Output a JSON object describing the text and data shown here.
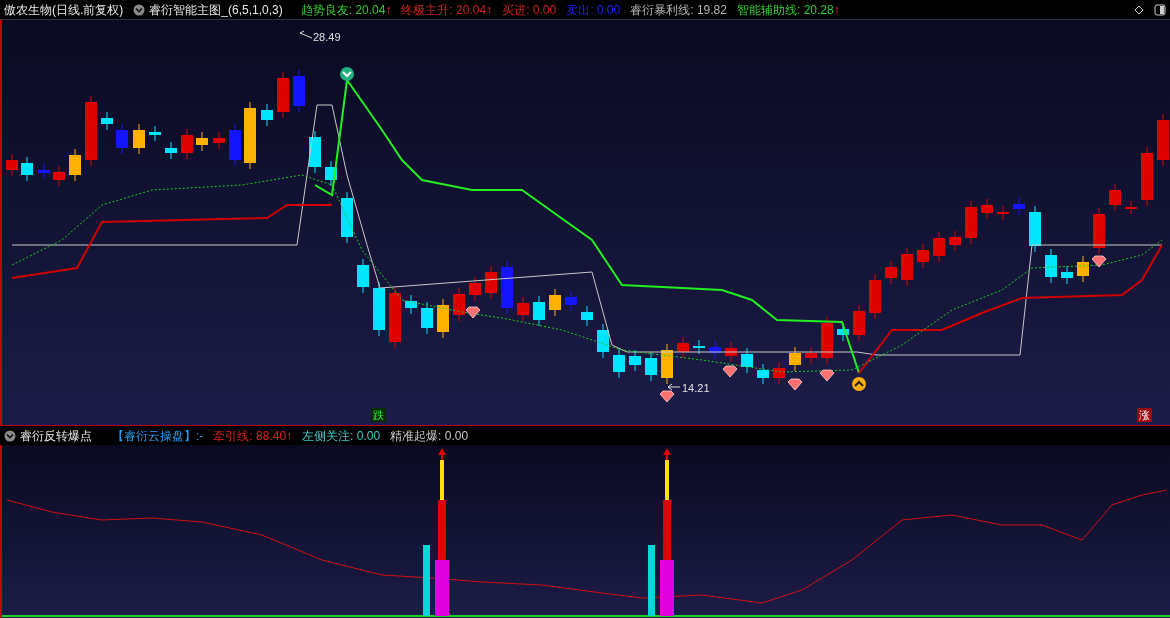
{
  "header": {
    "stock": "傲农生物(日线.前复权)",
    "indicator": "睿衍智能主图_(6,5,1,0,3)",
    "legend": [
      {
        "label": "趋势良友:",
        "value": "20.04",
        "arrow": "↑",
        "kind": "trend"
      },
      {
        "label": "终极主升:",
        "value": "20.04",
        "arrow": "↑",
        "kind": "rise"
      },
      {
        "label": "买进:",
        "value": "0.00",
        "kind": "buy"
      },
      {
        "label": "卖出:",
        "value": "0.00",
        "kind": "sell"
      },
      {
        "label": "睿衍暴利线:",
        "value": "19.82",
        "kind": "profit"
      },
      {
        "label": "智能辅助线:",
        "value": "20.28",
        "arrow": "↑",
        "kind": "assist"
      }
    ]
  },
  "main_chart": {
    "high_label": "28.49",
    "low_label": "14.21",
    "markers": [
      {
        "text": "跌",
        "kind": "fall"
      },
      {
        "text": "涨",
        "kind": "rise"
      }
    ]
  },
  "sub_header": {
    "title": "睿衍反转爆点",
    "legend": [
      {
        "label": "【睿衍云操盘】:-",
        "kind": "cloud"
      },
      {
        "label": "牵引线:",
        "value": "88.40",
        "arrow": "↑",
        "kind": "traction"
      },
      {
        "label": "左侧关注:",
        "value": "0.00",
        "kind": "watch"
      },
      {
        "label": "精准起爆:",
        "value": "0.00",
        "kind": "ignite"
      }
    ]
  }
}
